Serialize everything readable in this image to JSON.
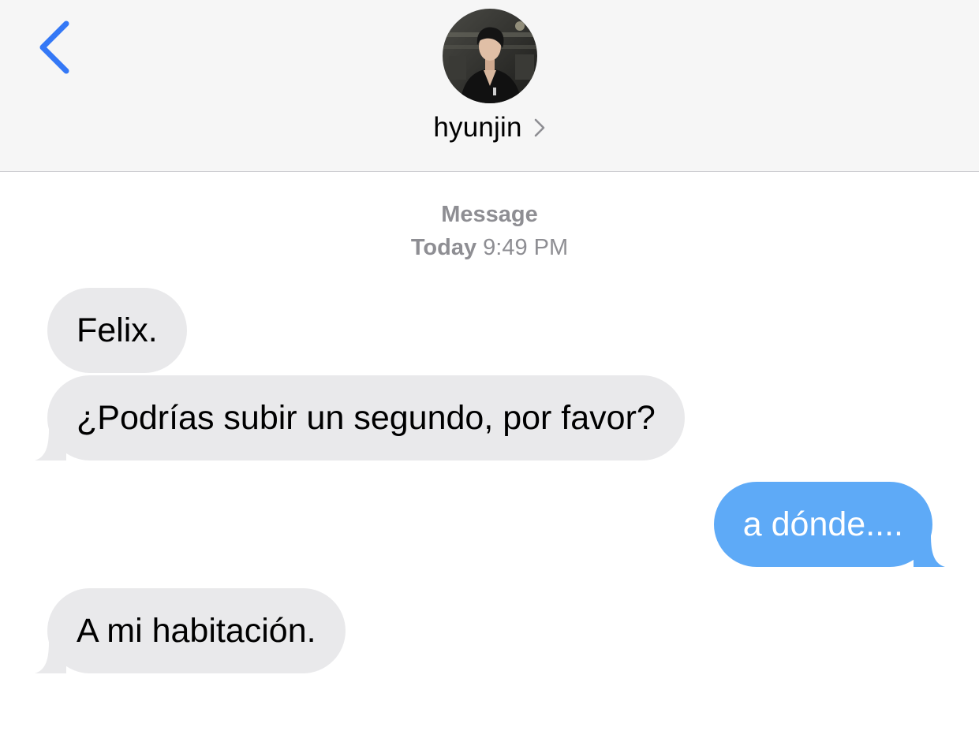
{
  "header": {
    "back_icon": "chevron-left-icon",
    "contact_name": "hyunjin",
    "contact_chevron_icon": "chevron-right-icon",
    "avatar": "contact-avatar-photo"
  },
  "conversation": {
    "service_label": "Message",
    "date_label": "Today",
    "time_label": "9:49 PM"
  },
  "messages": [
    {
      "direction": "incoming",
      "text": "Felix."
    },
    {
      "direction": "incoming",
      "text": "¿Podrías subir un segundo, por favor?"
    },
    {
      "direction": "outgoing",
      "text": "a dónde...."
    },
    {
      "direction": "incoming",
      "text": "A mi habitación."
    }
  ],
  "colors": {
    "header_bg": "#f6f6f6",
    "accent": "#3478f6",
    "incoming_bubble": "#e9e9eb",
    "outgoing_bubble": "#5eaaf7",
    "meta_text": "#8e8e93"
  }
}
